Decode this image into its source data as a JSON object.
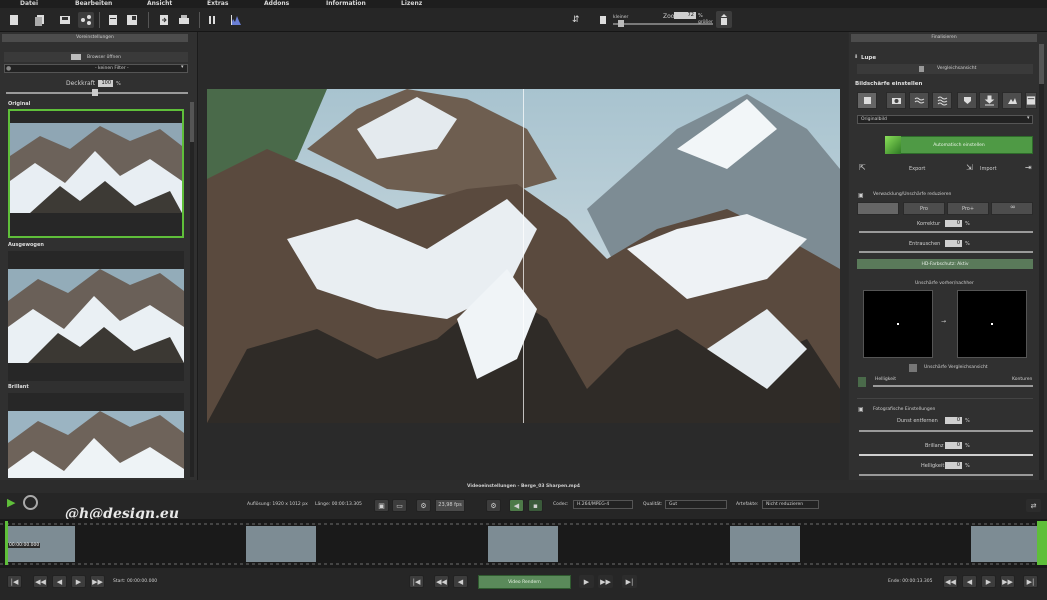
{
  "menu": [
    "Datei",
    "Bearbeiten",
    "Ansicht",
    "Extras",
    "Addons",
    "Information",
    "Lizenz"
  ],
  "toolbar": {
    "zoom_label": "Zoom",
    "zoom_value": "72",
    "zoom_unit": "%",
    "smaller_label": "kleiner",
    "bigger_label": "größer",
    "icons": [
      "new-file-icon",
      "open-file-icon",
      "save-icon",
      "share-icon",
      "crop-icon",
      "layout-icon",
      "export-icon",
      "print-icon",
      "pause-icon",
      "histogram-icon"
    ]
  },
  "left": {
    "header": "Voreinstellungen",
    "browser_label": "Browser öffnen",
    "filter_value": "- keinen Filter -",
    "opacity_label": "Deckkraft",
    "opacity_value": "100",
    "opacity_unit": "%",
    "presets": [
      "Original",
      "Ausgewogen",
      "Brillant"
    ]
  },
  "right": {
    "header": "Finalisieren",
    "lupe_label": "Lupe",
    "compare_label": "Vergleichsansicht",
    "sharpness_title": "Bildschärfe einstellen",
    "source_value": "Originalbild",
    "auto_button": "Automatisch einstellen",
    "export_label": "Export",
    "import_label": "Import",
    "blur_title": "Verwacklung/Unschärfe reduzieren",
    "mode_buttons": [
      "",
      "Pro",
      "Pro+",
      ""
    ],
    "korrektur_label": "Korrektur",
    "korrektur_value": "0",
    "entrauschen_label": "Entrauschen",
    "entrauschen_value": "0",
    "hd_protection": "HD-Farbschutz: Aktiv",
    "before_after_title": "Unschärfe vorher/nachher",
    "blur_compare_label": "Unschärfe Vergleichsansicht",
    "brightness_label": "Helligkeit",
    "contours_label": "Konturen",
    "photo_title": "Fotografische Einstellungen",
    "dunst_label": "Dunst entfernen",
    "dunst_value": "0",
    "brillanz_label": "Brillanz",
    "brillanz_value": "0",
    "helligkeit_label": "Helligkeit",
    "helligkeit_value": "0",
    "percent": "%"
  },
  "video": {
    "title": "Videoeinstellungen - Berge_03 Sharpen.mp4",
    "resolution": "Auflösung: 1920 x 1012 px",
    "length": "Länge: 00:00:13.305",
    "fps": "23,98 fps",
    "codec_label": "Codec:",
    "codec_value": "H.264/MPEG-4",
    "quality_label": "Qualität:",
    "quality_value": "Gut",
    "artifacts_label": "Artefakte:",
    "artifacts_value": "Nicht reduzieren",
    "timecode": "00:00:00.000",
    "start": "Start: 00:00:00.000",
    "end": "Ende: 00:00:13.305",
    "render_button": "Video Rendern"
  },
  "watermark": "@h@design.eu",
  "colors": {
    "accent_green": "#5fbf3a",
    "render_green": "#5a8a5a",
    "panel": "#303030"
  }
}
